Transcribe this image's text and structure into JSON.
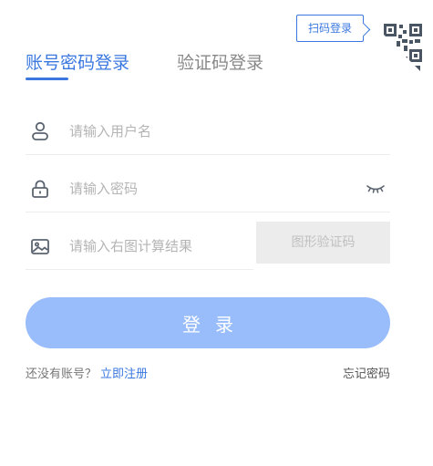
{
  "qr_login": {
    "tip_label": "扫码登录",
    "icon": "qr-code-icon"
  },
  "tabs": [
    {
      "label": "账号密码登录",
      "active": true
    },
    {
      "label": "验证码登录",
      "active": false
    }
  ],
  "fields": {
    "username": {
      "placeholder": "请输入用户名",
      "value": "",
      "icon": "user-icon"
    },
    "password": {
      "placeholder": "请输入密码",
      "value": "",
      "icon": "lock-icon",
      "toggle_icon": "eye-closed-icon"
    },
    "captcha": {
      "placeholder": "请输入右图计算结果",
      "value": "",
      "icon": "image-icon",
      "captcha_label": "图形验证码"
    }
  },
  "login_button": {
    "label": "登录"
  },
  "footer": {
    "no_account_text": "还没有账号？",
    "register_label": "立即注册",
    "forgot_label": "忘记密码"
  },
  "colors": {
    "accent": "#3a78e0",
    "button_bg": "#99bdfb",
    "captcha_bg": "#ececec",
    "divider": "#ededed",
    "placeholder": "#b4b4b4"
  }
}
